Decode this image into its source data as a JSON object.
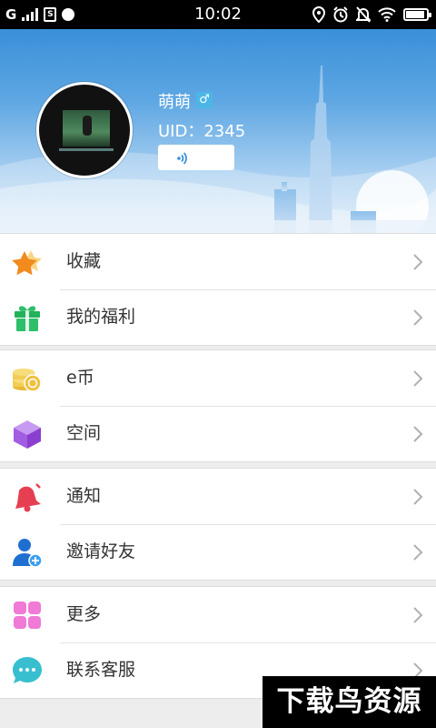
{
  "status_bar": {
    "carrier": "G",
    "time": "10:02",
    "icons": [
      "signal-icon",
      "sim-icon",
      "ball-icon",
      "location-icon",
      "alarm-icon",
      "mute-icon",
      "wifi-icon",
      "battery-icon"
    ]
  },
  "profile": {
    "username": "萌萌",
    "gender_symbol": "♂",
    "uid": "UID：2345",
    "sign_button_icon": "sign-wave-icon"
  },
  "colors": {
    "header_top": "#3a8fd9",
    "header_bottom": "#dcebf8",
    "divider": "#dcdcdc",
    "label_text": "#333333",
    "chevron": "#b0b0b0"
  },
  "menu": {
    "groups": [
      {
        "items": [
          {
            "label": "收藏",
            "icon": "star-icon"
          },
          {
            "label": "我的福利",
            "icon": "gift-icon"
          }
        ]
      },
      {
        "items": [
          {
            "label": "e币",
            "icon": "coins-icon"
          },
          {
            "label": "空间",
            "icon": "cube-icon"
          }
        ]
      },
      {
        "items": [
          {
            "label": "通知",
            "icon": "bell-icon"
          },
          {
            "label": "邀请好友",
            "icon": "add-friend-icon"
          }
        ]
      },
      {
        "items": [
          {
            "label": "更多",
            "icon": "grid-icon"
          },
          {
            "label": "联系客服",
            "icon": "chat-icon"
          }
        ]
      }
    ]
  },
  "watermark": "下载鸟资源"
}
